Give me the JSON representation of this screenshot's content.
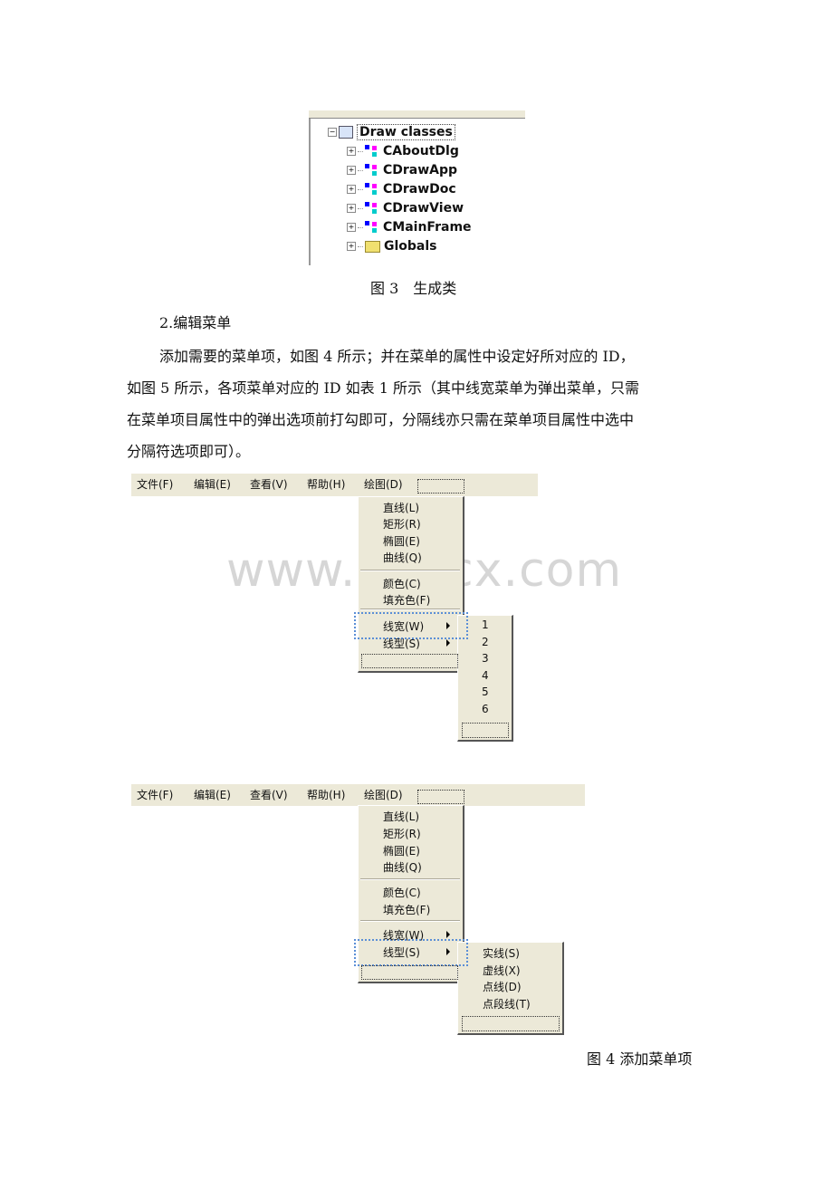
{
  "figure3": {
    "tree_root": "Draw classes",
    "classes": [
      "CAboutDlg",
      "CDrawApp",
      "CDrawDoc",
      "CDrawView",
      "CMainFrame"
    ],
    "globals": "Globals",
    "caption": "图 3　生成类"
  },
  "section_heading": "2.编辑菜单",
  "paragraph_lines": [
    "添加需要的菜单项，如图 4 所示；并在菜单的属性中设定好所对应的 ID，",
    "如图 5 所示，各项菜单对应的 ID 如表 1 所示（其中线宽菜单为弹出菜单，只需",
    "在菜单项目属性中的弹出选项前打勾即可，分隔线亦只需在菜单项目属性中选中",
    "分隔符选项即可）。"
  ],
  "menubar": [
    "文件(F)",
    "编辑(E)",
    "查看(V)",
    "帮助(H)",
    "绘图(D)"
  ],
  "draw_menu": {
    "group1": [
      "直线(L)",
      "矩形(R)",
      "椭圆(E)",
      "曲线(Q)"
    ],
    "group2": [
      "颜色(C)",
      "填充色(F)"
    ],
    "group3": [
      "线宽(W)",
      "线型(S)"
    ]
  },
  "line_width_submenu": [
    "1",
    "2",
    "3",
    "4",
    "5",
    "6"
  ],
  "line_style_submenu": [
    "实线(S)",
    "虚线(X)",
    "点线(D)",
    "点段线(T)"
  ],
  "watermark": "www.bdocx.com",
  "figure4_caption": "图 4  添加菜单项"
}
